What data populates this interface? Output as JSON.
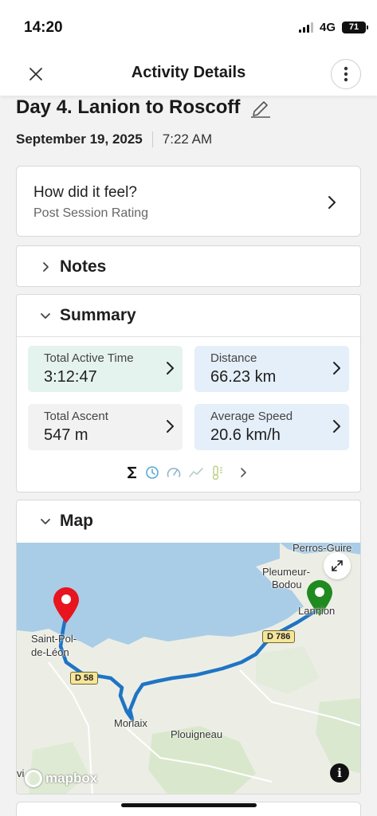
{
  "status_bar": {
    "time": "14:20",
    "network": "4G",
    "battery": "71"
  },
  "header": {
    "title": "Activity Details"
  },
  "activity": {
    "title": "Day 4. Lanion to Roscoff",
    "date": "September 19, 2025",
    "time": "7:22 AM"
  },
  "feel": {
    "title": "How did it feel?",
    "subtitle": "Post Session Rating"
  },
  "notes": {
    "label": "Notes"
  },
  "summary": {
    "label": "Summary",
    "stats": [
      {
        "label": "Total Active Time",
        "value": "3:12:47",
        "color": "#e5f3ee"
      },
      {
        "label": "Distance",
        "value": "66.23 km",
        "color": "#e5eff9"
      },
      {
        "label": "Total Ascent",
        "value": "547 m",
        "color": "#f2f2f2"
      },
      {
        "label": "Average Speed",
        "value": "20.6 km/h",
        "color": "#e5eff9"
      }
    ],
    "metric_icons": [
      "sigma-icon",
      "clock-icon",
      "speedometer-icon",
      "trend-icon",
      "thermometer-icon",
      "chevron-right-icon"
    ]
  },
  "map": {
    "label": "Map",
    "places": {
      "perros": "Perros-Guire",
      "pleumeur_1": "Pleumeur-",
      "pleumeur_2": "Bodou",
      "lannion": "Lannion",
      "saint_pol_1": "Saint-Pol-",
      "saint_pol_2": "de-Léon",
      "morlaix": "Morlaix",
      "plouigneau": "Plouigneau",
      "edge_label": "vi"
    },
    "roads": {
      "d786": "D 786",
      "d58": "D 58"
    },
    "attribution": "mapbox",
    "colors": {
      "water": "#a9cde6",
      "land": "#eceee6",
      "route": "#1f74c4",
      "start_pin": "#1f8a1f",
      "end_pin": "#e8141e"
    }
  }
}
